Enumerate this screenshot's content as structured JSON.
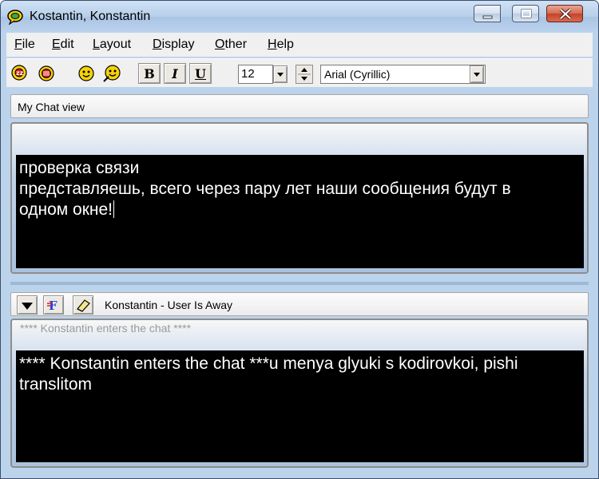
{
  "window": {
    "title": "Kostantin, Konstantin",
    "title_icon": "chat-bubble-icon",
    "controls": [
      "minimize-icon",
      "maximize-icon",
      "close-icon"
    ]
  },
  "menu": {
    "items": [
      {
        "label": "File",
        "accel": "F",
        "rest": "ile"
      },
      {
        "label": "Edit",
        "accel": "E",
        "rest": "dit"
      },
      {
        "label": "Layout",
        "accel": "L",
        "rest": "ayout"
      },
      {
        "label": "Display",
        "accel": "D",
        "rest": "isplay"
      },
      {
        "label": "Other",
        "accel": "O",
        "rest": "ther"
      },
      {
        "label": "Help",
        "accel": "H",
        "rest": "elp"
      }
    ]
  },
  "toolbar": {
    "icons": [
      "invite-chat-icon",
      "end-chat-icon",
      "emoticon-icon",
      "emoticon-gallery-icon"
    ],
    "bold_label": "B",
    "italic_label": "I",
    "underline_label": "U",
    "font_size": "12",
    "font_name": "Arial (Cyrillic)"
  },
  "my_chat": {
    "label": "My Chat view",
    "lines": [
      "проверка связи",
      "представляешь, всего через пару лет наши сообщения будут в",
      "одном окне!"
    ]
  },
  "peer_chat": {
    "status": "Konstantin - User Is Away",
    "header": "**** Konstantin enters the chat ****",
    "lines": [
      "**** Konstantin enters the chat ***u menya glyuki s kodirovkoi, pishi",
      "translitom"
    ],
    "controls": [
      "collapse-arrow-icon",
      "font-color-icon",
      "eraser-icon"
    ]
  },
  "colors": {
    "chat_bg": "#000000",
    "chat_text": "#ffffff",
    "frame": "#bcd3ec",
    "close_red": "#c3432a"
  }
}
